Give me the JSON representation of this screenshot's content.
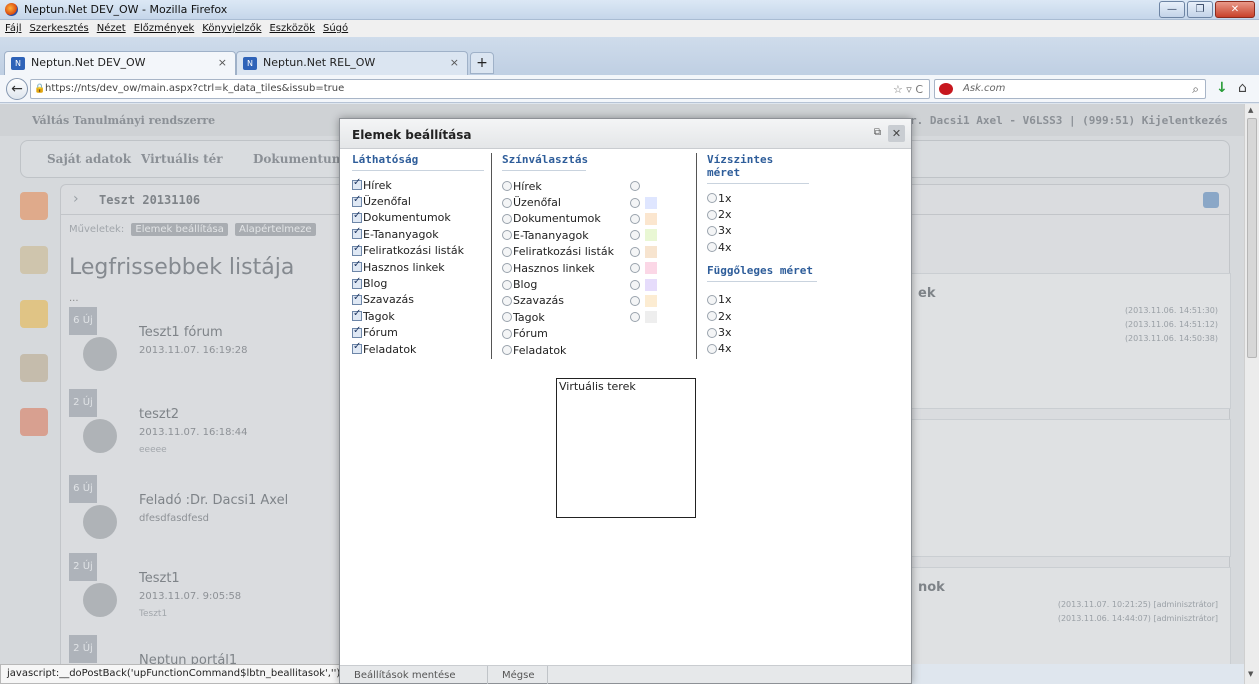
{
  "window": {
    "title": "Neptun.Net DEV_OW - Mozilla Firefox",
    "buttons": [
      "—",
      "❐",
      "✕"
    ]
  },
  "menubar": [
    "Fájl",
    "Szerkesztés",
    "Nézet",
    "Előzmények",
    "Könyvjelzők",
    "Eszközök",
    "Súgó"
  ],
  "tabs": [
    {
      "label": "Neptun.Net DEV_OW",
      "active": true
    },
    {
      "label": "Neptun.Net REL_OW",
      "active": false
    }
  ],
  "nav": {
    "url": "https://nts/dev_ow/main.aspx?ctrl=k_data_tiles&issub=true",
    "search_placeholder": "Ask.com"
  },
  "page": {
    "switch_link": "Váltás Tanulmányi rendszerre",
    "user_info": "r. Dacsi1 Axel - V6LSS3 | (999:51)  Kijelentkezés",
    "menu": [
      "Saját adatok",
      "Virtuális tér",
      "Dokumentumt"
    ],
    "panel_title": "Teszt 20131106",
    "operations_label": "Műveletek:",
    "op_buttons": [
      "Elemek beállítása",
      "Alapértelmeze"
    ],
    "list_title": "Legfrissebbek listája",
    "ellipsis": "...",
    "news": [
      {
        "badge": "6 Új",
        "title": "Teszt1 fórum",
        "date": "2013.11.07. 16:19:28",
        "sub": ""
      },
      {
        "badge": "2 Új",
        "title": "teszt2",
        "date": "2013.11.07. 16:18:44",
        "sub": "eeeee"
      },
      {
        "badge": "6 Új",
        "title": "Feladó :Dr. Dacsi1 Axel",
        "date": "dfesdfasdfesd",
        "sub": ""
      },
      {
        "badge": "2 Új",
        "title": "Teszt1",
        "date": "2013.11.07. 9:05:58",
        "sub": "Teszt1"
      },
      {
        "badge": "2 Új",
        "title": "Neptun portál1",
        "date": "",
        "sub": ""
      }
    ],
    "right_box_1": {
      "heading": "ek",
      "lines": [
        "(2013.11.06. 14:51:30)",
        "(2013.11.06. 14:51:12)",
        "(2013.11.06. 14:50:38)"
      ]
    },
    "right_box_3": {
      "heading": "nok",
      "lines": [
        "(2013.11.07. 10:21:25) [adminisztrátor]",
        "(2013.11.06. 14:44:07) [adminisztrátor]"
      ]
    }
  },
  "status": "javascript:__doPostBack('upFunctionCommand$lbtn_beallitasok','')",
  "modal": {
    "title": "Elemek beállítása",
    "visibility": {
      "heading": "Láthatóság",
      "items": [
        "Hírek",
        "Üzenőfal",
        "Dokumentumok",
        "E-Tananyagok",
        "Feliratkozási listák",
        "Hasznos linkek",
        "Blog",
        "Szavazás",
        "Tagok",
        "Fórum",
        "Feladatok"
      ]
    },
    "color": {
      "heading": "Színválasztás",
      "items": [
        "Hírek",
        "Üzenőfal",
        "Dokumentumok",
        "E-Tananyagok",
        "Feliratkozási listák",
        "Hasznos linkek",
        "Blog",
        "Szavazás",
        "Tagok",
        "Fórum",
        "Feladatok"
      ],
      "swatches": [
        "#ffffff",
        "#dfe6ff",
        "#fbe6cf",
        "#e9f7d4",
        "#f7e4cf",
        "#fbd7e6",
        "#e6dcfb",
        "#fcecd2",
        "#eeeeee"
      ]
    },
    "horizontal": {
      "heading": "Vízszintes méret",
      "options": [
        "1x",
        "2x",
        "3x",
        "4x"
      ]
    },
    "vertical": {
      "heading": "Függőleges méret",
      "options": [
        "1x",
        "2x",
        "3x",
        "4x"
      ]
    },
    "preview_label": "Virtuális terek",
    "footer_tabs": [
      "Beállítások mentése",
      "Mégse"
    ]
  }
}
